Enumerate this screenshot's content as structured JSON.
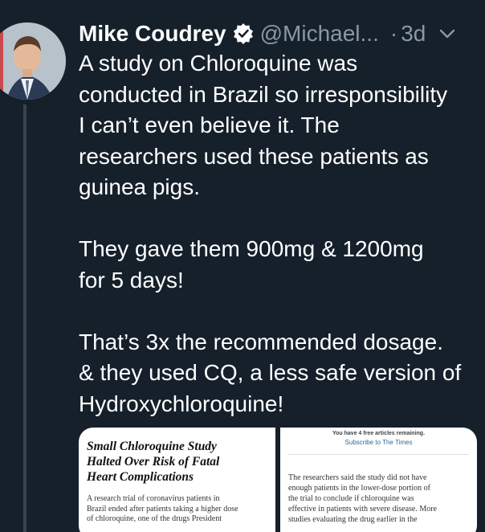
{
  "tweet": {
    "display_name": "Mike Coudrey",
    "handle": "@Michael...",
    "separator": "·",
    "time": "3d",
    "body_lines": [
      [
        "A study on Chloroquine was",
        "conducted in Brazil so irresponsibility",
        "I can’t even believe it. The",
        "researchers used these patients as",
        "guinea pigs."
      ],
      [
        "They gave them 900mg & 1200mg",
        "for 5 days!"
      ],
      [
        "That’s 3x the recommended dosage.",
        "& they used CQ, a less safe version of",
        "Hydroxychloroquine!"
      ]
    ]
  },
  "media": {
    "left": {
      "title_lines": [
        "Small Chloroquine Study",
        "Halted Over Risk of Fatal",
        "Heart Complications"
      ],
      "body_lines": [
        "A research trial of coronavirus patients in",
        "Brazil ended after patients taking a higher dose",
        "of chloroquine, one of the drugs President"
      ]
    },
    "right": {
      "paywall_note": "You have 4 free articles remaining.",
      "subscribe_link": "Subscribe to The Times",
      "body_lines": [
        "The researchers said the study did not have",
        "enough patients in the lower-dose portion of",
        "the trial to conclude if chloroquine was",
        "effective in patients with severe disease. More",
        "studies evaluating the drug earlier in the"
      ]
    }
  },
  "colors": {
    "background": "#15202b",
    "text_primary": "#ffffff",
    "text_secondary": "#8899a6",
    "thread_line": "#38444d",
    "verified_badge": "#ffffff"
  },
  "icons": {
    "verified": "verified-badge-icon",
    "more": "chevron-down-icon"
  }
}
